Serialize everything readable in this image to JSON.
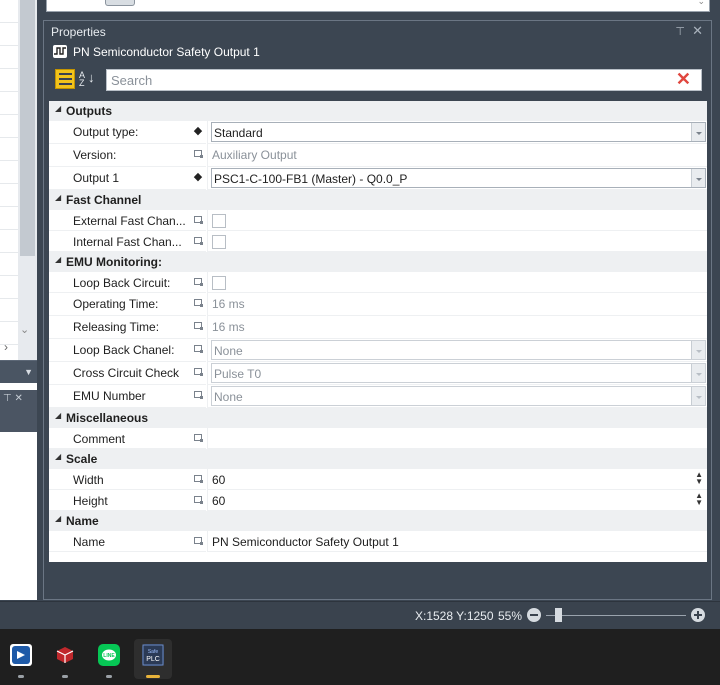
{
  "panel": {
    "title": "Properties",
    "object_name": "PN Semiconductor Safety Output 1",
    "search_placeholder": "Search"
  },
  "sections": [
    {
      "label": "Outputs",
      "rows": [
        {
          "name": "Output type:",
          "value": "Standard",
          "editor": "combo",
          "required": true
        },
        {
          "name": "Version:",
          "value": "Auxiliary Output",
          "editor": "readonly"
        },
        {
          "name": "Output 1",
          "value": "PSC1-C-100-FB1 (Master) - Q0.0_P",
          "editor": "combo",
          "required": true
        }
      ]
    },
    {
      "label": "Fast Channel",
      "rows": [
        {
          "name": "External Fast Chan...",
          "value": false,
          "editor": "checkbox"
        },
        {
          "name": "Internal Fast Chan...",
          "value": false,
          "editor": "checkbox"
        }
      ]
    },
    {
      "label": "EMU Monitoring:",
      "rows": [
        {
          "name": "Loop Back Circuit:",
          "value": false,
          "editor": "checkbox"
        },
        {
          "name": "Operating Time:",
          "value": "16 ms",
          "editor": "readonly"
        },
        {
          "name": "Releasing Time:",
          "value": "16 ms",
          "editor": "readonly"
        },
        {
          "name": "Loop Back Chanel:",
          "value": "None",
          "editor": "combo-disabled"
        },
        {
          "name": "Cross Circuit Check",
          "value": "Pulse T0",
          "editor": "combo-disabled"
        },
        {
          "name": "EMU Number",
          "value": "None",
          "editor": "combo-disabled"
        }
      ]
    },
    {
      "label": "Miscellaneous",
      "rows": [
        {
          "name": "Comment",
          "value": "",
          "editor": "text"
        }
      ]
    },
    {
      "label": "Scale",
      "rows": [
        {
          "name": "Width",
          "value": "60",
          "editor": "spin"
        },
        {
          "name": "Height",
          "value": "60",
          "editor": "spin"
        }
      ]
    },
    {
      "label": "Name",
      "rows": [
        {
          "name": "Name",
          "value": "PN Semiconductor Safety Output 1",
          "editor": "text"
        }
      ]
    }
  ],
  "status": {
    "coords": "X:1528 Y:1250",
    "zoom": "55%",
    "zoom_level": 55
  },
  "taskbar": {
    "apps": [
      {
        "name": "app-blue-icon",
        "active": false,
        "color": "#1e5aa8"
      },
      {
        "name": "app-red-cube-icon",
        "active": false,
        "color": "#c0282c"
      },
      {
        "name": "line-messenger-icon",
        "active": false,
        "color": "#06c755"
      },
      {
        "name": "safe-plc-icon",
        "active": true,
        "color": "#2b3a55",
        "label": "Safe PLC"
      }
    ]
  },
  "colors": {
    "panel_bg": "#3c4652",
    "grid_category_bg": "#eef0f2",
    "clear_search": "#e0463e",
    "active_indicator": "#e8b33a"
  }
}
